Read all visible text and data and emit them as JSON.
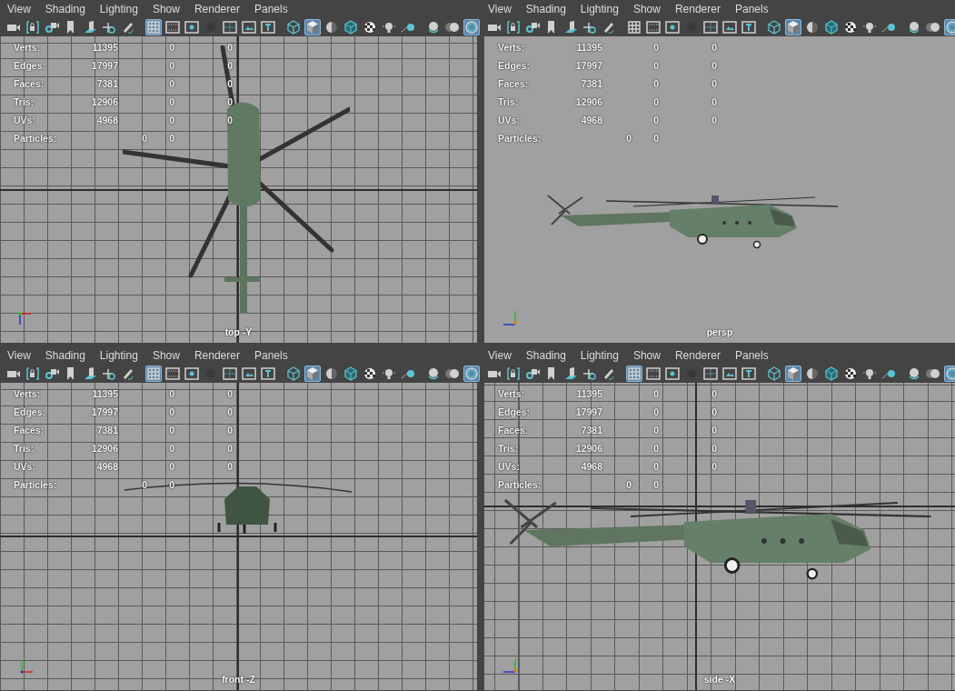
{
  "panels": [
    {
      "kind": "top",
      "menu": [
        "View",
        "Shading",
        "Lighting",
        "Show",
        "Renderer",
        "Panels"
      ],
      "toolbar": [
        {
          "kind": "camera",
          "selected": false
        },
        {
          "kind": "lock",
          "selected": false
        },
        {
          "kind": "camattr",
          "selected": false
        },
        {
          "kind": "bookmark",
          "selected": false
        },
        {
          "kind": "plane",
          "selected": false
        },
        {
          "kind": "pan",
          "selected": false
        },
        {
          "kind": "pencil",
          "selected": false
        },
        {
          "kind": "sep"
        },
        {
          "kind": "grid",
          "selected": true
        },
        {
          "kind": "film",
          "selected": false
        },
        {
          "kind": "resgate",
          "selected": false
        },
        {
          "kind": "mask",
          "selected": false
        },
        {
          "kind": "field",
          "selected": false
        },
        {
          "kind": "safeaction",
          "selected": false
        },
        {
          "kind": "safetitle",
          "selected": false
        },
        {
          "kind": "sep"
        },
        {
          "kind": "wire",
          "selected": false
        },
        {
          "kind": "shaded",
          "selected": true
        },
        {
          "kind": "material",
          "selected": false
        },
        {
          "kind": "wireshade",
          "selected": false
        },
        {
          "kind": "checker",
          "selected": false
        },
        {
          "kind": "light",
          "selected": false
        },
        {
          "kind": "shadow",
          "selected": false
        },
        {
          "kind": "sep"
        },
        {
          "kind": "ao",
          "selected": false
        },
        {
          "kind": "blur",
          "selected": false
        },
        {
          "kind": "aa",
          "selected": true
        }
      ],
      "grid": true,
      "stats": [
        {
          "kind": "count",
          "label": "Verts:",
          "values": [
            "11395",
            "0",
            "0"
          ]
        },
        {
          "kind": "count",
          "label": "Edges:",
          "values": [
            "17997",
            "0",
            "0"
          ]
        },
        {
          "kind": "count",
          "label": "Faces:",
          "values": [
            "7381",
            "0",
            "0"
          ]
        },
        {
          "kind": "count",
          "label": "Tris:",
          "values": [
            "12906",
            "0",
            "0"
          ]
        },
        {
          "kind": "count",
          "label": "UVs:",
          "values": [
            "4968",
            "0",
            "0"
          ]
        },
        {
          "kind": "particles",
          "label": "Particles:",
          "values": [
            "0",
            "0"
          ]
        }
      ],
      "camera": "top -Y"
    },
    {
      "kind": "persp",
      "menu": [
        "View",
        "Shading",
        "Lighting",
        "Show",
        "Renderer",
        "Panels"
      ],
      "toolbar": [
        {
          "kind": "camera",
          "selected": false
        },
        {
          "kind": "lock",
          "selected": false
        },
        {
          "kind": "camattr",
          "selected": false
        },
        {
          "kind": "bookmark",
          "selected": false
        },
        {
          "kind": "plane",
          "selected": false
        },
        {
          "kind": "pan",
          "selected": false
        },
        {
          "kind": "pencil",
          "selected": false
        },
        {
          "kind": "sep"
        },
        {
          "kind": "grid",
          "selected": false
        },
        {
          "kind": "film",
          "selected": false
        },
        {
          "kind": "resgate",
          "selected": false
        },
        {
          "kind": "mask",
          "selected": false
        },
        {
          "kind": "field",
          "selected": false
        },
        {
          "kind": "safeaction",
          "selected": false
        },
        {
          "kind": "safetitle",
          "selected": false
        },
        {
          "kind": "sep"
        },
        {
          "kind": "wire",
          "selected": false
        },
        {
          "kind": "shaded",
          "selected": true
        },
        {
          "kind": "material",
          "selected": false
        },
        {
          "kind": "wireshade",
          "selected": false
        },
        {
          "kind": "checker",
          "selected": false
        },
        {
          "kind": "light",
          "selected": false
        },
        {
          "kind": "shadow",
          "selected": false
        },
        {
          "kind": "sep"
        },
        {
          "kind": "ao",
          "selected": false
        },
        {
          "kind": "blur",
          "selected": false
        },
        {
          "kind": "aa",
          "selected": true
        }
      ],
      "grid": false,
      "stats": [
        {
          "kind": "count",
          "label": "Verts:",
          "values": [
            "11395",
            "0",
            "0"
          ]
        },
        {
          "kind": "count",
          "label": "Edges:",
          "values": [
            "17997",
            "0",
            "0"
          ]
        },
        {
          "kind": "count",
          "label": "Faces:",
          "values": [
            "7381",
            "0",
            "0"
          ]
        },
        {
          "kind": "count",
          "label": "Tris:",
          "values": [
            "12906",
            "0",
            "0"
          ]
        },
        {
          "kind": "count",
          "label": "UVs:",
          "values": [
            "4968",
            "0",
            "0"
          ]
        },
        {
          "kind": "particles",
          "label": "Particles:",
          "values": [
            "0",
            "0"
          ]
        }
      ],
      "camera": "persp"
    },
    {
      "kind": "front",
      "menu": [
        "View",
        "Shading",
        "Lighting",
        "Show",
        "Renderer",
        "Panels"
      ],
      "toolbar": [
        {
          "kind": "camera",
          "selected": false
        },
        {
          "kind": "lock",
          "selected": false
        },
        {
          "kind": "camattr",
          "selected": false
        },
        {
          "kind": "bookmark",
          "selected": false
        },
        {
          "kind": "plane",
          "selected": false
        },
        {
          "kind": "pan",
          "selected": false
        },
        {
          "kind": "pencil",
          "selected": false
        },
        {
          "kind": "sep"
        },
        {
          "kind": "grid",
          "selected": true
        },
        {
          "kind": "film",
          "selected": false
        },
        {
          "kind": "resgate",
          "selected": false
        },
        {
          "kind": "mask",
          "selected": false
        },
        {
          "kind": "field",
          "selected": false
        },
        {
          "kind": "safeaction",
          "selected": false
        },
        {
          "kind": "safetitle",
          "selected": false
        },
        {
          "kind": "sep"
        },
        {
          "kind": "wire",
          "selected": false
        },
        {
          "kind": "shaded",
          "selected": true
        },
        {
          "kind": "material",
          "selected": false
        },
        {
          "kind": "wireshade",
          "selected": false
        },
        {
          "kind": "checker",
          "selected": false
        },
        {
          "kind": "light",
          "selected": false
        },
        {
          "kind": "shadow",
          "selected": false
        },
        {
          "kind": "sep"
        },
        {
          "kind": "ao",
          "selected": false
        },
        {
          "kind": "blur",
          "selected": false
        },
        {
          "kind": "aa",
          "selected": true
        }
      ],
      "grid": true,
      "stats": [
        {
          "kind": "count",
          "label": "Verts:",
          "values": [
            "11395",
            "0",
            "0"
          ]
        },
        {
          "kind": "count",
          "label": "Edges:",
          "values": [
            "17997",
            "0",
            "0"
          ]
        },
        {
          "kind": "count",
          "label": "Faces:",
          "values": [
            "7381",
            "0",
            "0"
          ]
        },
        {
          "kind": "count",
          "label": "Tris:",
          "values": [
            "12906",
            "0",
            "0"
          ]
        },
        {
          "kind": "count",
          "label": "UVs:",
          "values": [
            "4968",
            "0",
            "0"
          ]
        },
        {
          "kind": "particles",
          "label": "Particles:",
          "values": [
            "0",
            "0"
          ]
        }
      ],
      "camera": "front -Z"
    },
    {
      "kind": "side",
      "menu": [
        "View",
        "Shading",
        "Lighting",
        "Show",
        "Renderer",
        "Panels"
      ],
      "toolbar": [
        {
          "kind": "camera",
          "selected": false
        },
        {
          "kind": "lock",
          "selected": false
        },
        {
          "kind": "camattr",
          "selected": false
        },
        {
          "kind": "bookmark",
          "selected": false
        },
        {
          "kind": "plane",
          "selected": false
        },
        {
          "kind": "pan",
          "selected": false
        },
        {
          "kind": "pencil",
          "selected": false
        },
        {
          "kind": "sep"
        },
        {
          "kind": "grid",
          "selected": true
        },
        {
          "kind": "film",
          "selected": false
        },
        {
          "kind": "resgate",
          "selected": false
        },
        {
          "kind": "mask",
          "selected": false
        },
        {
          "kind": "field",
          "selected": false
        },
        {
          "kind": "safeaction",
          "selected": false
        },
        {
          "kind": "safetitle",
          "selected": false
        },
        {
          "kind": "sep"
        },
        {
          "kind": "wire",
          "selected": false
        },
        {
          "kind": "shaded",
          "selected": true
        },
        {
          "kind": "material",
          "selected": false
        },
        {
          "kind": "wireshade",
          "selected": false
        },
        {
          "kind": "checker",
          "selected": false
        },
        {
          "kind": "light",
          "selected": false
        },
        {
          "kind": "shadow",
          "selected": false
        },
        {
          "kind": "sep"
        },
        {
          "kind": "ao",
          "selected": false
        },
        {
          "kind": "blur",
          "selected": false
        },
        {
          "kind": "aa",
          "selected": true
        }
      ],
      "grid": true,
      "stats": [
        {
          "kind": "count",
          "label": "Verts:",
          "values": [
            "11395",
            "0",
            "0"
          ]
        },
        {
          "kind": "count",
          "label": "Edges:",
          "values": [
            "17997",
            "0",
            "0"
          ]
        },
        {
          "kind": "count",
          "label": "Faces:",
          "values": [
            "7381",
            "0",
            "0"
          ]
        },
        {
          "kind": "count",
          "label": "Tris:",
          "values": [
            "12906",
            "0",
            "0"
          ]
        },
        {
          "kind": "count",
          "label": "UVs:",
          "values": [
            "4968",
            "0",
            "0"
          ]
        },
        {
          "kind": "particles",
          "label": "Particles:",
          "values": [
            "0",
            "0"
          ]
        }
      ],
      "camera": "side -X"
    }
  ]
}
